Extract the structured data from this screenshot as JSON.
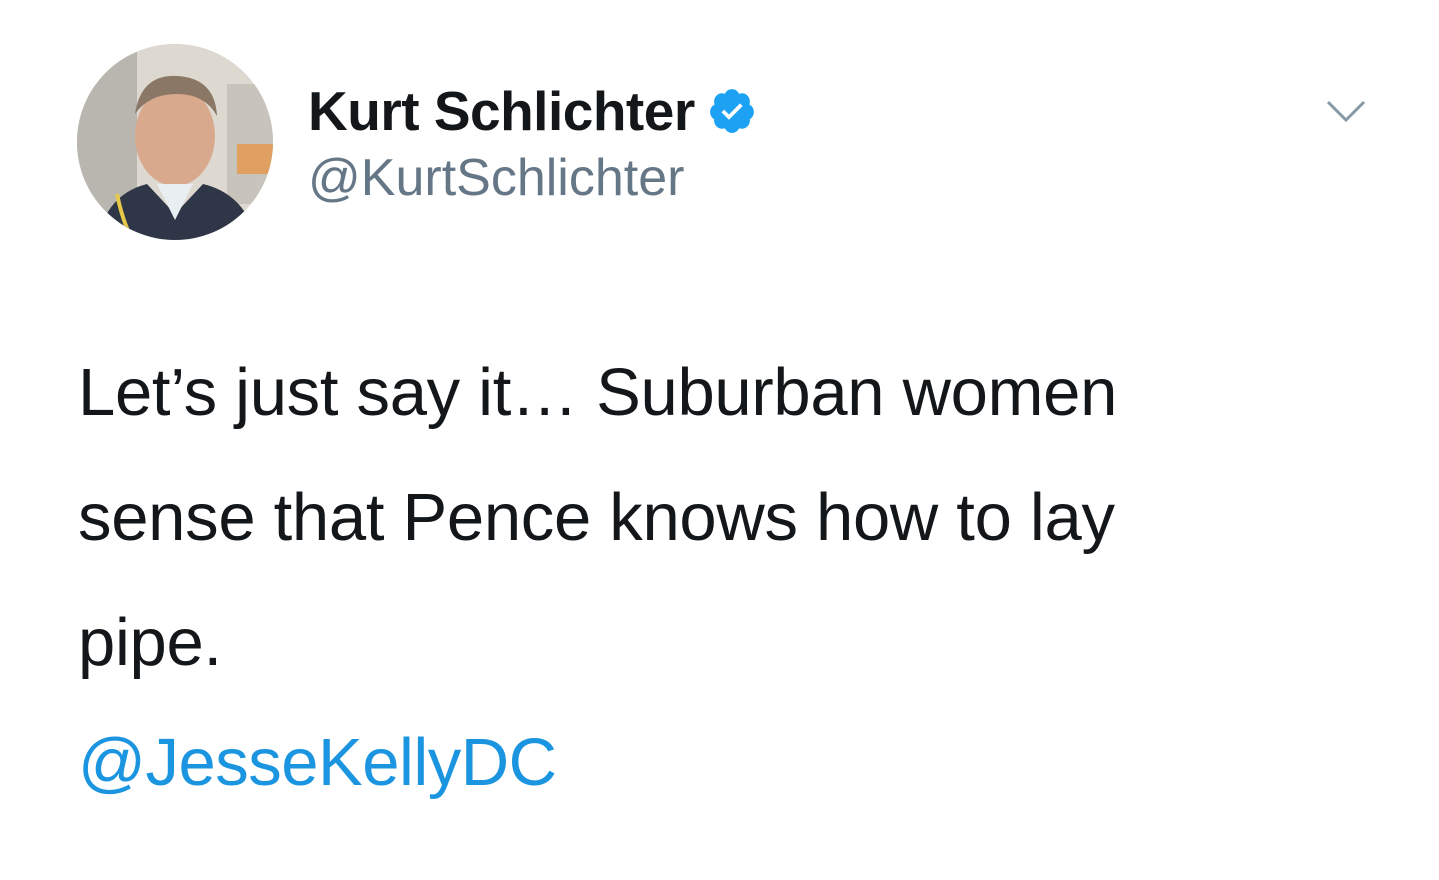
{
  "author": {
    "display_name": "Kurt Schlichter",
    "handle": "@KurtSchlichter",
    "verified": true,
    "avatar_icon": "profile-photo"
  },
  "tweet": {
    "line1": "Let’s just say it… Suburban women",
    "line2": "sense that Pence knows how to lay",
    "line3": "pipe.",
    "mention": "@JesseKellyDC"
  },
  "icons": {
    "verified": "verified-badge-icon",
    "menu": "chevron-down-icon"
  },
  "colors": {
    "text": "#14171a",
    "secondary": "#657786",
    "link": "#1b95e0",
    "verified": "#1da1f2",
    "background": "#ffffff"
  }
}
